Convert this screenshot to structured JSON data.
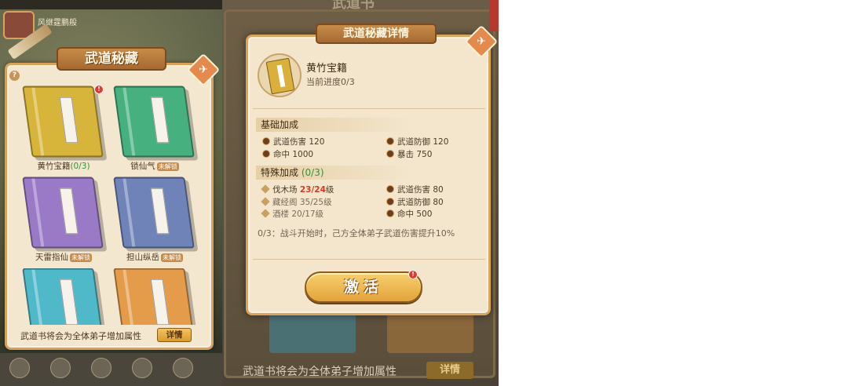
{
  "left_panel": {
    "title": "武道秘藏",
    "player_name": "风继霆鹏般",
    "books": [
      {
        "name": "黄竹宝籍",
        "progress": "(0/3)",
        "locked": false,
        "color": "#d7b43a",
        "alert": true
      },
      {
        "name": "锁仙气",
        "progress": "",
        "locked": true,
        "color": "#46b07e",
        "alert": false
      },
      {
        "name": "天雷指仙",
        "progress": "",
        "locked": true,
        "color": "#9a79c6",
        "alert": false
      },
      {
        "name": "担山纵岳",
        "progress": "",
        "locked": true,
        "color": "#6f83b8",
        "alert": false
      },
      {
        "name": "",
        "progress": "",
        "locked": false,
        "color": "#4fb8c9",
        "alert": false
      },
      {
        "name": "",
        "progress": "",
        "locked": false,
        "color": "#e49b4a",
        "alert": false
      }
    ],
    "lock_label": "未解锁",
    "footer_text": "武道书将会为全体弟子增加属性",
    "detail_button": "详情"
  },
  "right_panel": {
    "bg_title": "武道书",
    "bg_footer_text": "武道书将会为全体弟子增加属性",
    "bg_detail_button": "详情",
    "modal_title": "武道秘藏详情",
    "book_name": "黄竹宝籍",
    "book_progress": "当前进度0/3",
    "base_section": "基础加成",
    "base_stats": [
      {
        "label": "武道伤害",
        "value": "120"
      },
      {
        "label": "武道防御",
        "value": "120"
      },
      {
        "label": "命中",
        "value": "1000"
      },
      {
        "label": "暴击",
        "value": "750"
      }
    ],
    "special_section": "特殊加成",
    "special_count": "(0/3)",
    "requirements": [
      {
        "label": "伐木场",
        "value": "23/24",
        "suffix": "级",
        "met": false
      },
      {
        "label": "藏经阁",
        "value": "35/25",
        "suffix": "级",
        "met": true
      },
      {
        "label": "酒楼",
        "value": "20/17",
        "suffix": "级",
        "met": true
      }
    ],
    "special_stats": [
      {
        "label": "武道伤害",
        "value": "80"
      },
      {
        "label": "武道防御",
        "value": "80"
      },
      {
        "label": "命中",
        "value": "500"
      }
    ],
    "description": "0/3：战斗开始时，己方全体弟子武道伤害提升10%",
    "activate_button": "激活"
  },
  "colors": {
    "panel_bg": "#f4e7cf",
    "frame": "#d8a15a",
    "accent_green": "#3a8f3a",
    "accent_red": "#d43a22",
    "button_gold": "#e3a33a"
  }
}
